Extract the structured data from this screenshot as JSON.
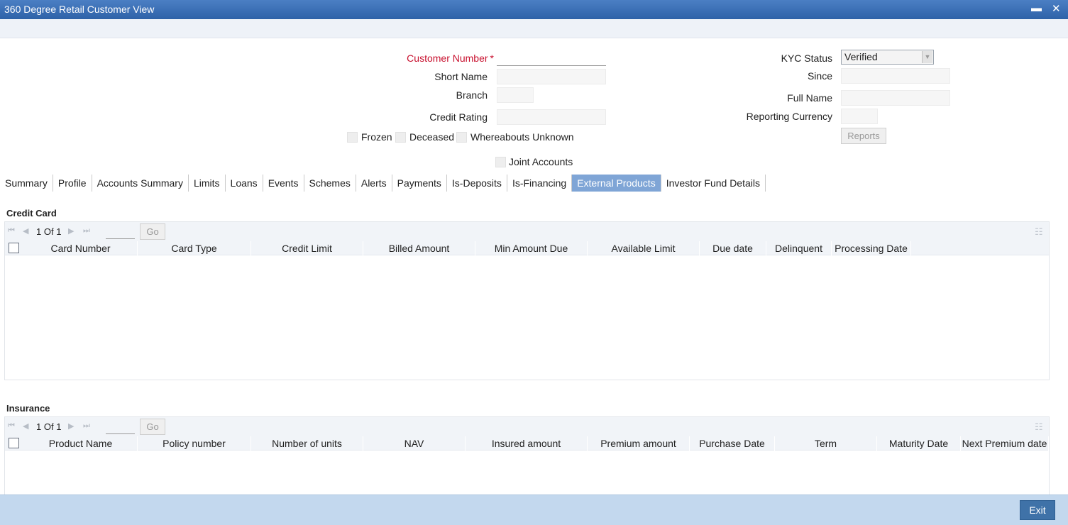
{
  "window": {
    "title": "360 Degree Retail Customer View",
    "minimize": "▬",
    "close": "✕"
  },
  "form": {
    "customer_number_label": "Customer Number",
    "customer_number_required": "*",
    "customer_number_value": "",
    "short_name_label": "Short Name",
    "branch_label": "Branch",
    "credit_rating_label": "Credit Rating",
    "kyc_status_label": "KYC Status",
    "kyc_status_value": "Verified",
    "since_label": "Since",
    "full_name_label": "Full Name",
    "reporting_currency_label": "Reporting Currency",
    "reports_button": "Reports",
    "frozen_label": "Frozen",
    "deceased_label": "Deceased",
    "whereabouts_label": "Whereabouts Unknown",
    "joint_accounts_label": "Joint Accounts"
  },
  "tabs": [
    {
      "label": "Summary"
    },
    {
      "label": "Profile"
    },
    {
      "label": "Accounts Summary"
    },
    {
      "label": "Limits"
    },
    {
      "label": "Loans"
    },
    {
      "label": "Events"
    },
    {
      "label": "Schemes"
    },
    {
      "label": "Alerts"
    },
    {
      "label": "Payments"
    },
    {
      "label": "Is-Deposits"
    },
    {
      "label": "Is-Financing"
    },
    {
      "label": "External Products",
      "active": true
    },
    {
      "label": "Investor Fund Details"
    }
  ],
  "credit_card": {
    "title": "Credit Card",
    "page_current": "1",
    "page_of": "Of",
    "page_total": "1",
    "go_label": "Go",
    "columns": [
      "Card Number",
      "Card Type",
      "Credit Limit",
      "Billed Amount",
      "Min Amount Due",
      "Available Limit",
      "Due date",
      "Delinquent",
      "Processing Date"
    ]
  },
  "insurance": {
    "title": "Insurance",
    "page_current": "1",
    "page_of": "Of",
    "page_total": "1",
    "go_label": "Go",
    "columns": [
      "Product Name",
      "Policy number",
      "Number of units",
      "NAV",
      "Insured amount",
      "Premium amount",
      "Purchase Date",
      "Term",
      "Maturity Date",
      "Next Premium date"
    ]
  },
  "footer": {
    "exit_label": "Exit"
  },
  "icons": {
    "first": "⏮",
    "prev": "◀",
    "next": "▶",
    "last": "⏭",
    "grid_menu": "☷",
    "dropdown": "▼"
  },
  "colors": {
    "title_bar": "#3a6db5",
    "active_tab": "#7fa5d6",
    "required_label": "#c8102e",
    "footer": "#c3d8ee",
    "exit_button": "#3f72a8"
  }
}
